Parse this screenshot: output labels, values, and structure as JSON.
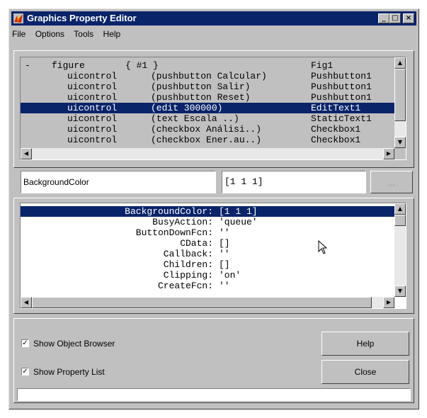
{
  "window": {
    "title": "Graphics Property Editor",
    "controls": [
      "_",
      "□",
      "×"
    ]
  },
  "menu": [
    "File",
    "Options",
    "Tools",
    "Help"
  ],
  "object_browser": {
    "rows": [
      {
        "toggle": "-",
        "type": "figure",
        "desc": "{ #1 }",
        "tag": "Fig1",
        "selected": false
      },
      {
        "toggle": "",
        "type": "uicontrol",
        "desc": "(pushbutton Calcular)",
        "tag": "Pushbutton1",
        "selected": false
      },
      {
        "toggle": "",
        "type": "uicontrol",
        "desc": "(pushbutton Salir)",
        "tag": "Pushbutton1",
        "selected": false
      },
      {
        "toggle": "",
        "type": "uicontrol",
        "desc": "(pushbutton Reset)",
        "tag": "Pushbutton1",
        "selected": false
      },
      {
        "toggle": "",
        "type": "uicontrol",
        "desc": "(edit 300000)",
        "tag": "EditText1",
        "selected": true
      },
      {
        "toggle": "",
        "type": "uicontrol",
        "desc": "(text Escala ..)",
        "tag": "StaticText1",
        "selected": false
      },
      {
        "toggle": "",
        "type": "uicontrol",
        "desc": "(checkbox Análisi..)",
        "tag": "Checkbox1",
        "selected": false
      },
      {
        "toggle": "",
        "type": "uicontrol",
        "desc": "(checkbox Ener.au..)",
        "tag": "Checkbox1",
        "selected": false
      }
    ]
  },
  "property_fields": {
    "name": "BackgroundColor",
    "value": "[1 1 1]",
    "browse_label": "..."
  },
  "property_list": {
    "rows": [
      {
        "name": "BackgroundColor:",
        "value": "[1 1 1]",
        "selected": true
      },
      {
        "name": "BusyAction:",
        "value": "'queue'",
        "selected": false
      },
      {
        "name": "ButtonDownFcn:",
        "value": "''",
        "selected": false
      },
      {
        "name": "CData:",
        "value": "[]",
        "selected": false
      },
      {
        "name": "Callback:",
        "value": "''",
        "selected": false
      },
      {
        "name": "Children:",
        "value": "[]",
        "selected": false
      },
      {
        "name": "Clipping:",
        "value": "'on'",
        "selected": false
      },
      {
        "name": "CreateFcn:",
        "value": "''",
        "selected": false
      }
    ]
  },
  "options": {
    "show_object_browser": {
      "label": "Show Object Browser",
      "checked": true
    },
    "show_property_list": {
      "label": "Show Property List",
      "checked": true
    }
  },
  "buttons": {
    "help": "Help",
    "close": "Close"
  },
  "status_text": "",
  "colors": {
    "title_bar": "#0a246a",
    "selection": "#0a246a",
    "face": "#c0c0c0"
  }
}
